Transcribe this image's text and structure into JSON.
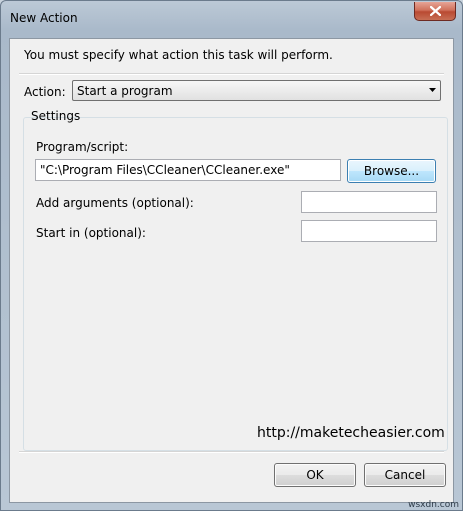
{
  "window": {
    "title": "New Action"
  },
  "prompt": "You must specify what action this task will perform.",
  "action": {
    "label": "Action:",
    "selected": "Start a program"
  },
  "settings": {
    "group_label": "Settings",
    "program_label": "Program/script:",
    "program_value": "\"C:\\Program Files\\CCleaner\\CCleaner.exe\"",
    "browse_label": "Browse...",
    "args_label": "Add arguments (optional):",
    "args_value": "",
    "start_label": "Start in (optional):",
    "start_value": ""
  },
  "watermark": "http://maketecheasier.com",
  "buttons": {
    "ok": "OK",
    "cancel": "Cancel"
  },
  "corner_badge": "wsxdn.com",
  "icons": {
    "close": "close-icon",
    "dropdown": "chevron-down-icon"
  },
  "colors": {
    "close_button": "#c75a43",
    "focus_border": "#3c7fb1"
  }
}
